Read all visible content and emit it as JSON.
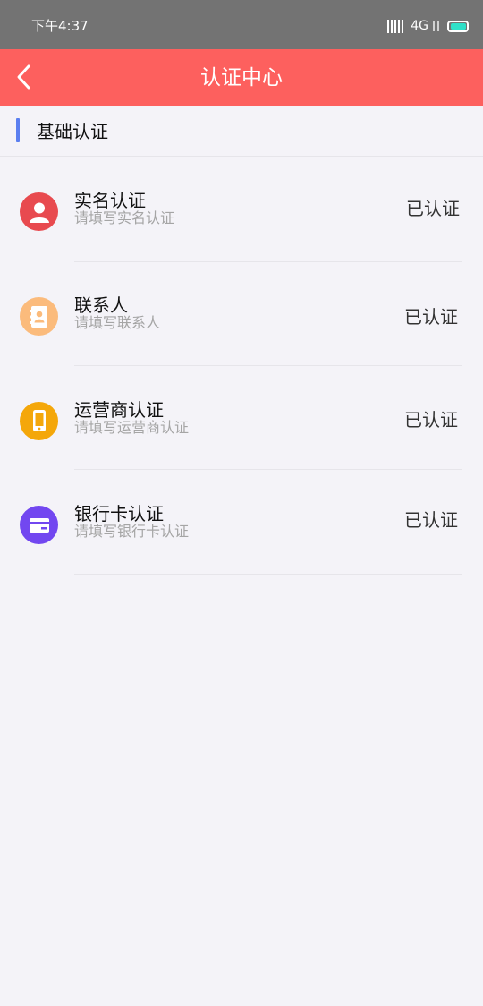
{
  "status_bar": {
    "time": "下午4:37",
    "network": "4G",
    "signal_icon": "signal-icon",
    "battery_icon": "battery-icon",
    "battery_color": "#2fe0c8"
  },
  "nav": {
    "title": "认证中心",
    "back_icon": "chevron-left-icon",
    "background": "#fd605e"
  },
  "section": {
    "title": "基础认证",
    "accent": "#5b7ff0"
  },
  "items": [
    {
      "title": "实名认证",
      "subtitle": "请填写实名认证",
      "status": "已认证",
      "icon": "person-icon",
      "icon_color": "#e84a4f"
    },
    {
      "title": "联系人",
      "subtitle": "请填写联系人",
      "status": "已认证",
      "icon": "contacts-book-icon",
      "icon_color": "#fbbb7c"
    },
    {
      "title": "运营商认证",
      "subtitle": "请填写运营商认证",
      "status": "已认证",
      "icon": "phone-icon",
      "icon_color": "#f4a70a"
    },
    {
      "title": "银行卡认证",
      "subtitle": "请填写银行卡认证",
      "status": "已认证",
      "icon": "bank-card-icon",
      "icon_color": "#7247f0"
    }
  ]
}
